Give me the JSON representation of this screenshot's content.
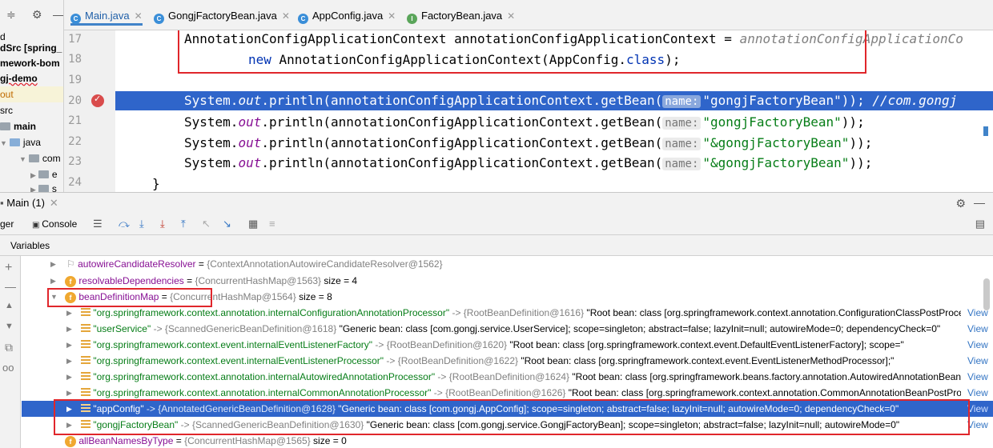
{
  "project_tree": {
    "items": [
      "d",
      "dSrc [spring_",
      "mework-bom",
      "gj-demo",
      "out",
      "src",
      "main",
      "java",
      "com",
      "e",
      "s"
    ]
  },
  "editor_tabs": [
    {
      "label": "Main.java",
      "icon": "class-icon",
      "active": true
    },
    {
      "label": "GongjFactoryBean.java",
      "icon": "class-icon",
      "active": false
    },
    {
      "label": "AppConfig.java",
      "icon": "class-icon",
      "active": false
    },
    {
      "label": "FactoryBean.java",
      "icon": "interface-icon",
      "active": false
    }
  ],
  "code": {
    "line_numbers": [
      "17",
      "18",
      "19",
      "20",
      "21",
      "22",
      "23",
      "24"
    ],
    "line17": {
      "text": "AnnotationConfigApplicationContext annotationConfigApplicationContext = ",
      "hint": "annotationConfigApplicationCo"
    },
    "line18": {
      "kw": "new",
      "text_a": " AnnotationConfigApplicationContext(AppConfig.",
      "kw2": "class",
      "text_b": ");"
    },
    "line20": {
      "pre": "System.",
      "field": "out",
      "mid": ".println(annotationConfigApplicationContext.getBean(",
      "param": "name:",
      "str": "\"gongjFactoryBean\"",
      "post": ")); ",
      "comment": "//com.gongj"
    },
    "line21": {
      "pre": "System.",
      "field": "out",
      "mid": ".println(annotationConfigApplicationContext.getBean(",
      "param": "name:",
      "str": "\"gongjFactoryBean\"",
      "post": "));"
    },
    "line22": {
      "pre": "System.",
      "field": "out",
      "mid": ".println(annotationConfigApplicationContext.getBean(",
      "param": "name:",
      "str": "\"&gongjFactoryBean\"",
      "post": "));"
    },
    "line23": {
      "pre": "System.",
      "field": "out",
      "mid": ".println(annotationConfigApplicationContext.getBean(",
      "param": "name:",
      "str": "\"&gongjFactoryBean\"",
      "post": "));"
    },
    "line24": "}"
  },
  "debug": {
    "session_tab": "Main (1)",
    "ger_tab": "ger",
    "console_tab": "Console",
    "variables_label": "Variables",
    "view_label": "View",
    "colors": {
      "selection": "#2f65ca",
      "highlight_box": "#e0262b"
    }
  },
  "variables": [
    {
      "kind": "field-pinned",
      "name": "autowireCandidateResolver",
      "eq": " = ",
      "ref": "{ContextAnnotationAutowireCandidateResolver@1562}",
      "extra": ""
    },
    {
      "kind": "field",
      "name": "resolvableDependencies",
      "eq": " = ",
      "ref": "{ConcurrentHashMap@1563}",
      "extra": "  size = 4"
    },
    {
      "kind": "field-open",
      "name": "beanDefinitionMap",
      "eq": " = ",
      "ref": "{ConcurrentHashMap@1564}",
      "extra": "  size = 8"
    },
    {
      "kind": "entry",
      "key": "\"org.springframework.context.annotation.internalConfigurationAnnotationProcessor\"",
      "arrow": " -> ",
      "ref": "{RootBeanDefinition@1616}",
      "value": " \"Root bean: class [org.springframework.context.annotation.ConfigurationClassPostProcessor]\""
    },
    {
      "kind": "entry",
      "key": "\"userService\"",
      "arrow": " -> ",
      "ref": "{ScannedGenericBeanDefinition@1618}",
      "value": " \"Generic bean: class [com.gongj.service.UserService]; scope=singleton; abstract=false; lazyInit=null; autowireMode=0; dependencyCheck=0\""
    },
    {
      "kind": "entry",
      "key": "\"org.springframework.context.event.internalEventListenerFactory\"",
      "arrow": " -> ",
      "ref": "{RootBeanDefinition@1620}",
      "value": " \"Root bean: class [org.springframework.context.event.DefaultEventListenerFactory]; scope=\""
    },
    {
      "kind": "entry",
      "key": "\"org.springframework.context.event.internalEventListenerProcessor\"",
      "arrow": " -> ",
      "ref": "{RootBeanDefinition@1622}",
      "value": " \"Root bean: class [org.springframework.context.event.EventListenerMethodProcessor];\""
    },
    {
      "kind": "entry",
      "key": "\"org.springframework.context.annotation.internalAutowiredAnnotationProcessor\"",
      "arrow": " -> ",
      "ref": "{RootBeanDefinition@1624}",
      "value": " \"Root bean: class [org.springframework.beans.factory.annotation.AutowiredAnnotationBeanPostProcessor]\""
    },
    {
      "kind": "entry",
      "key": "\"org.springframework.context.annotation.internalCommonAnnotationProcessor\"",
      "arrow": " -> ",
      "ref": "{RootBeanDefinition@1626}",
      "value": " \"Root bean: class [org.springframework.context.annotation.CommonAnnotationBeanPostProcessor]\""
    },
    {
      "kind": "entry-sel",
      "key": "\"appConfig\"",
      "arrow": " -> ",
      "ref": "{AnnotatedGenericBeanDefinition@1628}",
      "value": " \"Generic bean: class [com.gongj.AppConfig]; scope=singleton; abstract=false; lazyInit=null; autowireMode=0; dependencyCheck=0\""
    },
    {
      "kind": "entry",
      "key": "\"gongjFactoryBean\"",
      "arrow": " -> ",
      "ref": "{ScannedGenericBeanDefinition@1630}",
      "value": " \"Generic bean: class [com.gongj.service.GongjFactoryBean]; scope=singleton; abstract=false; lazyInit=null; autowireMode=0\""
    },
    {
      "kind": "field",
      "name": "allBeanNamesByType",
      "eq": " = ",
      "ref": "{ConcurrentHashMap@1565}",
      "extra": "  size = 0"
    }
  ]
}
